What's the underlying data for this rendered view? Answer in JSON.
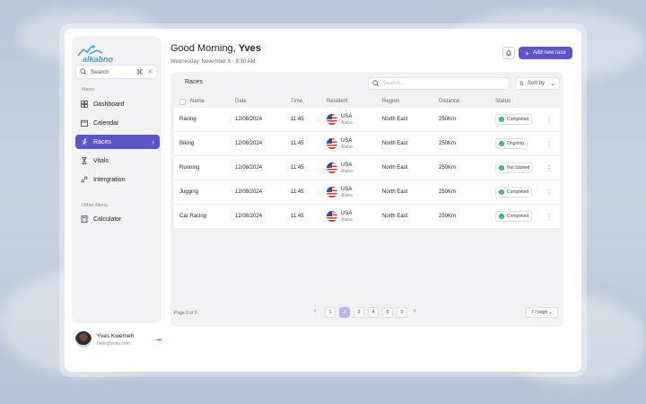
{
  "sidebar": {
    "logo_text": "alkabno",
    "search_label": "Search",
    "search_shortcut": "K",
    "menu_label": "Menu",
    "items": [
      {
        "label": "Dashboard"
      },
      {
        "label": "Calendar"
      },
      {
        "label": "Races"
      },
      {
        "label": "Vitals"
      },
      {
        "label": "Intergration"
      }
    ],
    "other_label": "Other Menu",
    "other_items": [
      {
        "label": "Calculator"
      }
    ],
    "profile": {
      "name": "Yves Kwemeh",
      "email": "hello@yves.com"
    }
  },
  "header": {
    "greeting": "Good Morning, ",
    "name": "Yves",
    "date": "Wednesday, November 6  ·  8:30 AM",
    "add_label": "Add new race"
  },
  "panel": {
    "title": "Races",
    "search_placeholder": "Search...",
    "sort_label": "Sort by",
    "columns": [
      "Name",
      "Date",
      "Time",
      "Resident",
      "Region",
      "Distance",
      "Status"
    ],
    "rows": [
      {
        "name": "Racing",
        "date": "12/08/2024",
        "time": "11:45",
        "country": "USA",
        "city": "Alaba",
        "region": "North East",
        "distance": "250Km",
        "status": "Completed"
      },
      {
        "name": "Biking",
        "date": "12/08/2024",
        "time": "11:45",
        "country": "USA",
        "city": "Alaba",
        "region": "North East",
        "distance": "250Km",
        "status": "Ongoing"
      },
      {
        "name": "Running",
        "date": "12/08/2024",
        "time": "11:45",
        "country": "USA",
        "city": "Alaba",
        "region": "North East",
        "distance": "250Km",
        "status": "Not Started"
      },
      {
        "name": "Jugging",
        "date": "12/08/2024",
        "time": "11:45",
        "country": "USA",
        "city": "Alaba",
        "region": "North East",
        "distance": "250Km",
        "status": "Completed"
      },
      {
        "name": "Car Racing",
        "date": "12/08/2024",
        "time": "11:45",
        "country": "USA",
        "city": "Alaba",
        "region": "North East",
        "distance": "250Km",
        "status": "Completed"
      }
    ],
    "pagination": {
      "label": "Page 2 of 9",
      "pages": [
        "1",
        "2",
        "3",
        "4",
        "5",
        "9"
      ],
      "active": "2",
      "per_page": "7 / page"
    }
  },
  "colors": {
    "accent": "#5c55c9",
    "status_dot": "#34b36b"
  }
}
